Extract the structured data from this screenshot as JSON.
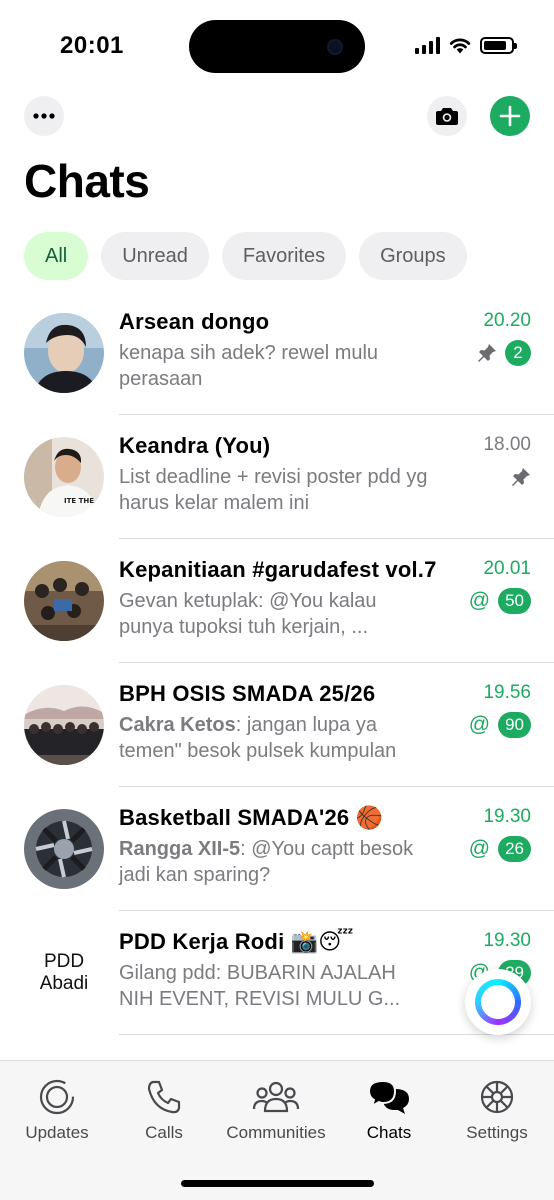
{
  "status_bar": {
    "time": "20:01",
    "battery_level": 0.85
  },
  "header": {
    "title": "Chats",
    "more_icon": "ellipsis-icon",
    "camera_icon": "camera-icon",
    "new_chat_icon": "plus-icon",
    "accent": "#1daa61"
  },
  "filters": [
    {
      "label": "All",
      "active": true
    },
    {
      "label": "Unread",
      "active": false
    },
    {
      "label": "Favorites",
      "active": false
    },
    {
      "label": "Groups",
      "active": false
    }
  ],
  "chats": [
    {
      "name": "Arsean dongo",
      "preview": "kenapa sih adek? rewel mulu perasaan",
      "time": "20.20",
      "pinned": true,
      "unread": "2"
    },
    {
      "name": "Keandra (You)",
      "preview": "List deadline + revisi poster pdd yg harus kelar malem ini",
      "time": "18.00",
      "pinned": true
    },
    {
      "name": "Kepanitiaan #garudafest vol.7",
      "preview": "Gevan ketuplak: @You kalau punya tupoksi tuh kerjain, ...",
      "time": "20.01",
      "mention": "@",
      "unread": "50"
    },
    {
      "name": "BPH OSIS SMADA 25/26",
      "sender": "Cakra Ketos",
      "preview": ": jangan lupa ya temen\" besok pulsek kumpulan",
      "time": "19.56",
      "mention": "@",
      "unread": "90"
    },
    {
      "name": "Basketball SMADA'26 🏀",
      "sender": "Rangga XII-5",
      "preview": ": @You captt besok jadi kan sparing?",
      "time": "19.30",
      "mention": "@",
      "unread": "26"
    },
    {
      "name": "PDD Kerja Rodi 📸😴",
      "preview": "Gilang pdd: BUBARIN AJALAH NIH EVENT, REVISI MULU G...",
      "time": "19.30",
      "mention": "@",
      "unread": "29",
      "avatar_text": [
        "PDD",
        "Abadi"
      ]
    }
  ],
  "tabs": [
    {
      "label": "Updates",
      "icon": "updates-icon"
    },
    {
      "label": "Calls",
      "icon": "phone-icon"
    },
    {
      "label": "Communities",
      "icon": "communities-icon"
    },
    {
      "label": "Chats",
      "icon": "chats-icon",
      "active": true
    },
    {
      "label": "Settings",
      "icon": "gear-icon"
    }
  ]
}
